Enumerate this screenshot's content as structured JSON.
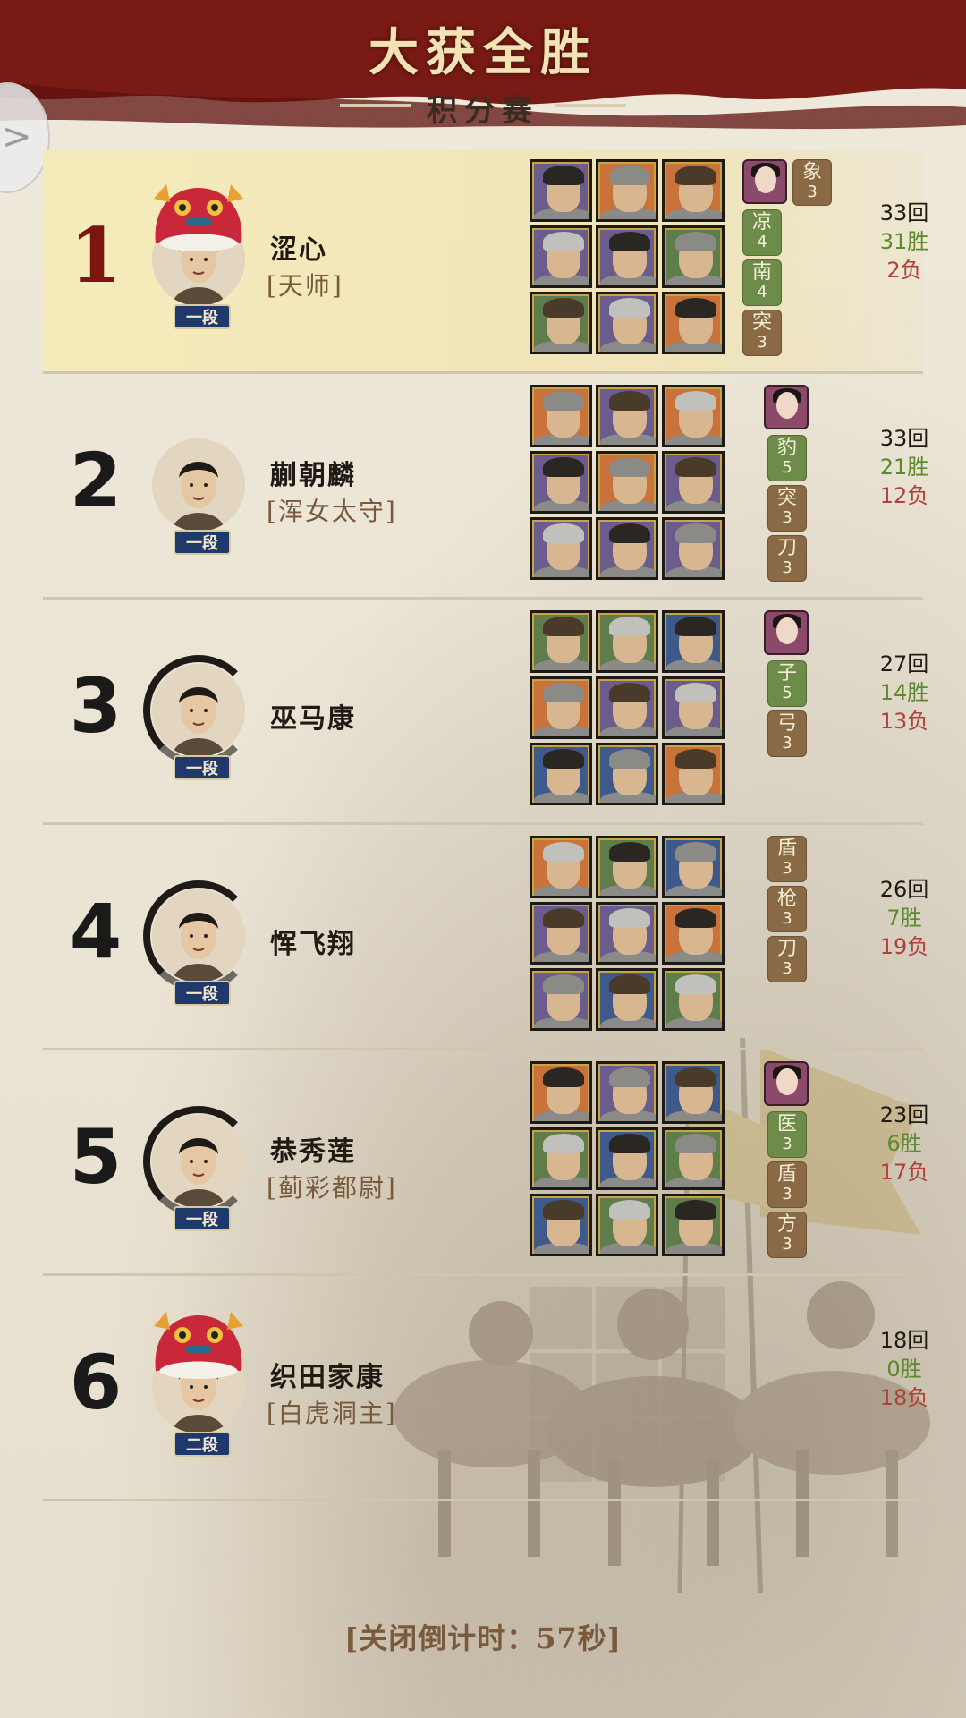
{
  "header": {
    "title": "大获全胜",
    "subtitle": "积分赛",
    "side_button_icon": "chevron-right-icon"
  },
  "colors": {
    "banner_red": "#7a1a14",
    "rank_gold": "#7a1510",
    "win_green": "#5c8a2c",
    "loss_red": "#b0403c",
    "tag_green": "#6d8c4a",
    "tag_brown": "#8a6a45",
    "grade_blue": "#1f3a6a",
    "highlight_row": "#f3e8b8"
  },
  "rows": [
    {
      "rank": "1",
      "name": "涩心",
      "title": "[天师]",
      "grade": "一段",
      "avatar_style": "lion-hat",
      "rounds": "33回",
      "wins": "31胜",
      "losses": "2负",
      "has_portrait_tag": true,
      "tags": [
        {
          "text": "象",
          "num": "3",
          "color": "brown"
        },
        {
          "text": "凉",
          "num": "4",
          "color": "green"
        },
        {
          "text": "南",
          "num": "4",
          "color": "green"
        },
        {
          "text": "突",
          "num": "3",
          "color": "brown"
        }
      ],
      "unit_bgs": [
        "#6a5d8e",
        "#c9723a",
        "#c9723a",
        "#6a5d8e",
        "#6a5d8e",
        "#5f7d4a",
        "#5f7d4a",
        "#6a5d8e",
        "#c9723a"
      ]
    },
    {
      "rank": "2",
      "name": "蒯朝麟",
      "title": "[浑女太守]",
      "grade": "一段",
      "avatar_style": "plain",
      "rounds": "33回",
      "wins": "21胜",
      "losses": "12负",
      "has_portrait_tag": true,
      "tags": [
        {
          "text": "豹",
          "num": "5",
          "color": "green"
        },
        {
          "text": "突",
          "num": "3",
          "color": "brown"
        },
        {
          "text": "刀",
          "num": "3",
          "color": "brown"
        }
      ],
      "unit_bgs": [
        "#c9723a",
        "#6a5d8e",
        "#c9723a",
        "#6a5d8e",
        "#c9723a",
        "#6a5d8e",
        "#6a5d8e",
        "#6a5d8e",
        "#6a5d8e"
      ]
    },
    {
      "rank": "3",
      "name": "巫马康",
      "title": "",
      "grade": "一段",
      "avatar_style": "ink",
      "rounds": "27回",
      "wins": "14胜",
      "losses": "13负",
      "has_portrait_tag": true,
      "tags": [
        {
          "text": "子",
          "num": "5",
          "color": "green"
        },
        {
          "text": "弓",
          "num": "3",
          "color": "brown"
        }
      ],
      "unit_bgs": [
        "#5f7d4a",
        "#5f7d4a",
        "#3d5a8a",
        "#c9723a",
        "#6a5d8e",
        "#6a5d8e",
        "#3d5a8a",
        "#3d5a8a",
        "#c9723a"
      ]
    },
    {
      "rank": "4",
      "name": "恽飞翔",
      "title": "",
      "grade": "一段",
      "avatar_style": "ink",
      "rounds": "26回",
      "wins": "7胜",
      "losses": "19负",
      "has_portrait_tag": false,
      "tags": [
        {
          "text": "盾",
          "num": "3",
          "color": "brown"
        },
        {
          "text": "枪",
          "num": "3",
          "color": "brown"
        },
        {
          "text": "刀",
          "num": "3",
          "color": "brown"
        }
      ],
      "unit_bgs": [
        "#c9723a",
        "#5f7d4a",
        "#3d5a8a",
        "#6a5d8e",
        "#6a5d8e",
        "#c9723a",
        "#6a5d8e",
        "#3d5a8a",
        "#5f7d4a"
      ]
    },
    {
      "rank": "5",
      "name": "恭秀莲",
      "title": "[蓟彩都尉]",
      "grade": "一段",
      "avatar_style": "ink",
      "rounds": "23回",
      "wins": "6胜",
      "losses": "17负",
      "has_portrait_tag": true,
      "tags": [
        {
          "text": "医",
          "num": "3",
          "color": "green"
        },
        {
          "text": "盾",
          "num": "3",
          "color": "brown"
        },
        {
          "text": "方",
          "num": "3",
          "color": "brown"
        }
      ],
      "unit_bgs": [
        "#c9723a",
        "#6a5d8e",
        "#3d5a8a",
        "#5f7d4a",
        "#3d5a8a",
        "#5f7d4a",
        "#3d5a8a",
        "#5f7d4a",
        "#5f7d4a"
      ]
    },
    {
      "rank": "6",
      "name": "织田家康",
      "title": "[白虎洞主]",
      "grade": "二段",
      "avatar_style": "lion-hat",
      "rounds": "18回",
      "wins": "0胜",
      "losses": "18负",
      "has_portrait_tag": false,
      "tags": [],
      "unit_bgs": []
    }
  ],
  "footer": {
    "countdown": "[关闭倒计时：57秒]"
  }
}
